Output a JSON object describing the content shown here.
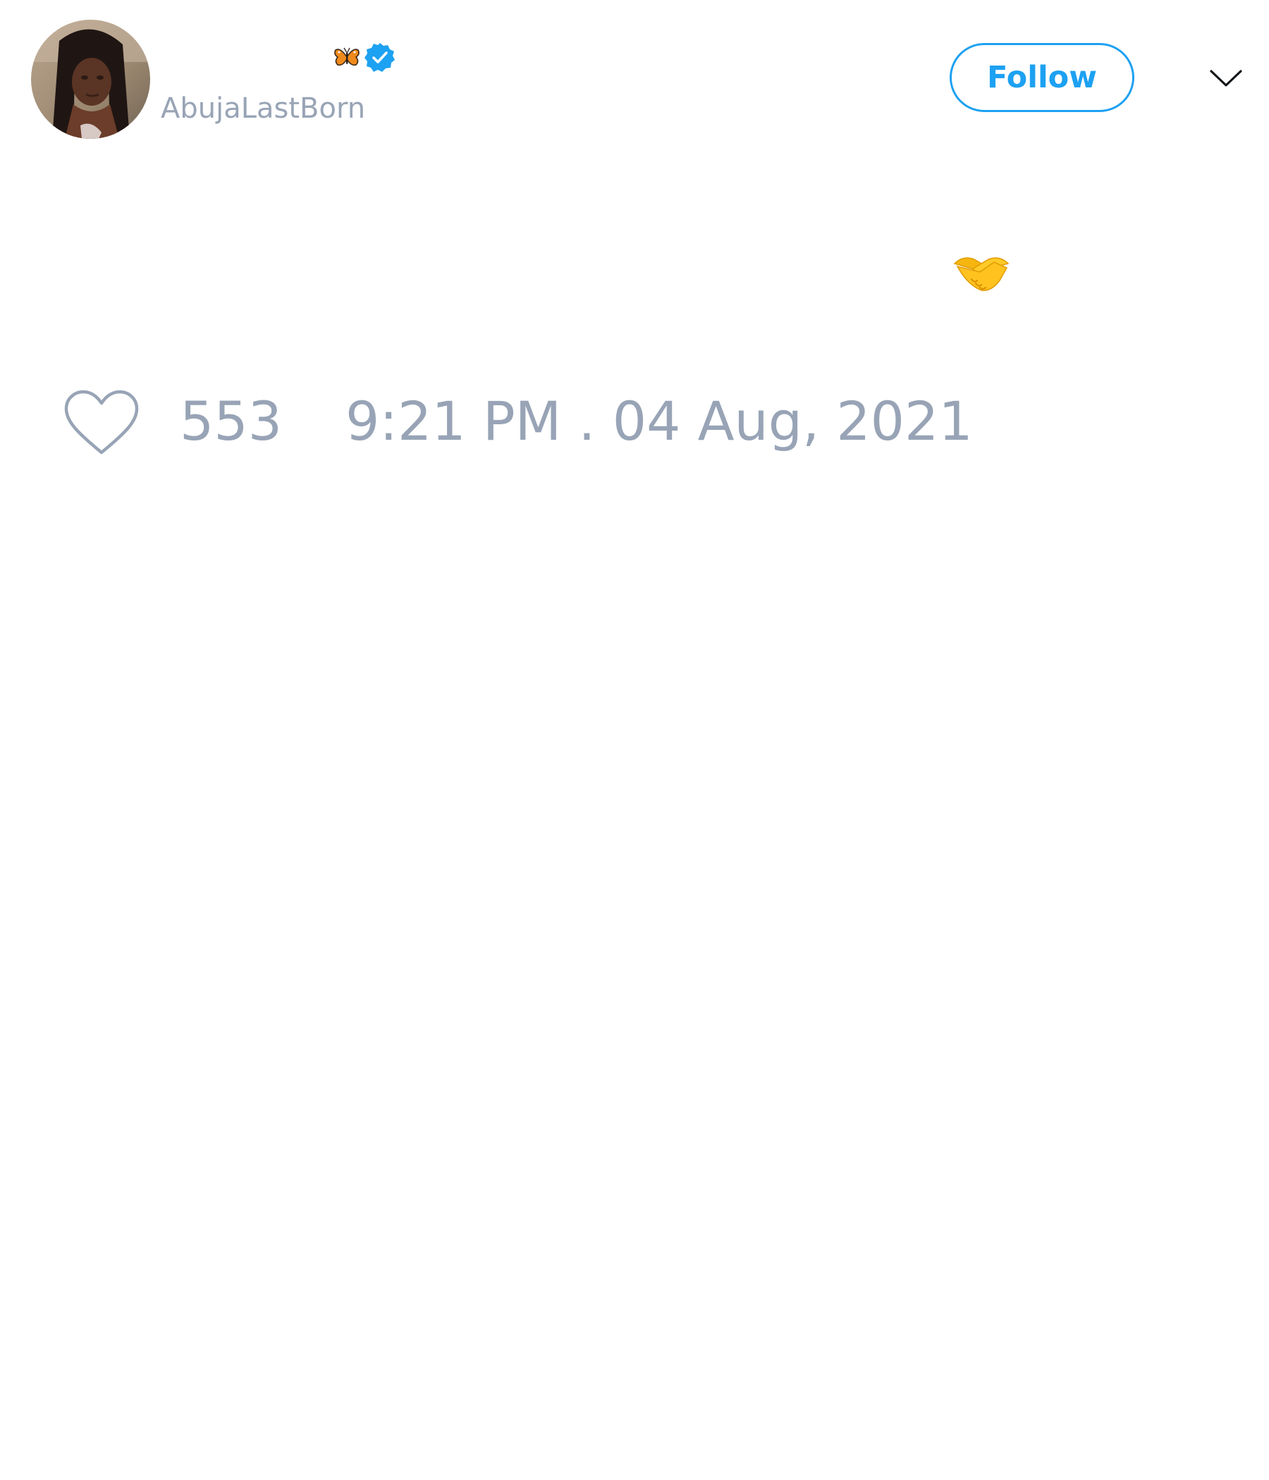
{
  "user": {
    "display_name": "",
    "handle": "AbujaLastBorn",
    "verified": true,
    "name_emoji": "butterfly-icon"
  },
  "actions": {
    "follow_label": "Follow",
    "menu_icon": "chevron-down-icon"
  },
  "tweet": {
    "text": "",
    "emoji": "handshake-icon"
  },
  "stats": {
    "likes": "553",
    "timestamp": "9:21 PM . 04 Aug, 2021"
  },
  "colors": {
    "accent": "#1da1f2",
    "muted_text": "#98a4b6",
    "background": "#ffffff"
  }
}
